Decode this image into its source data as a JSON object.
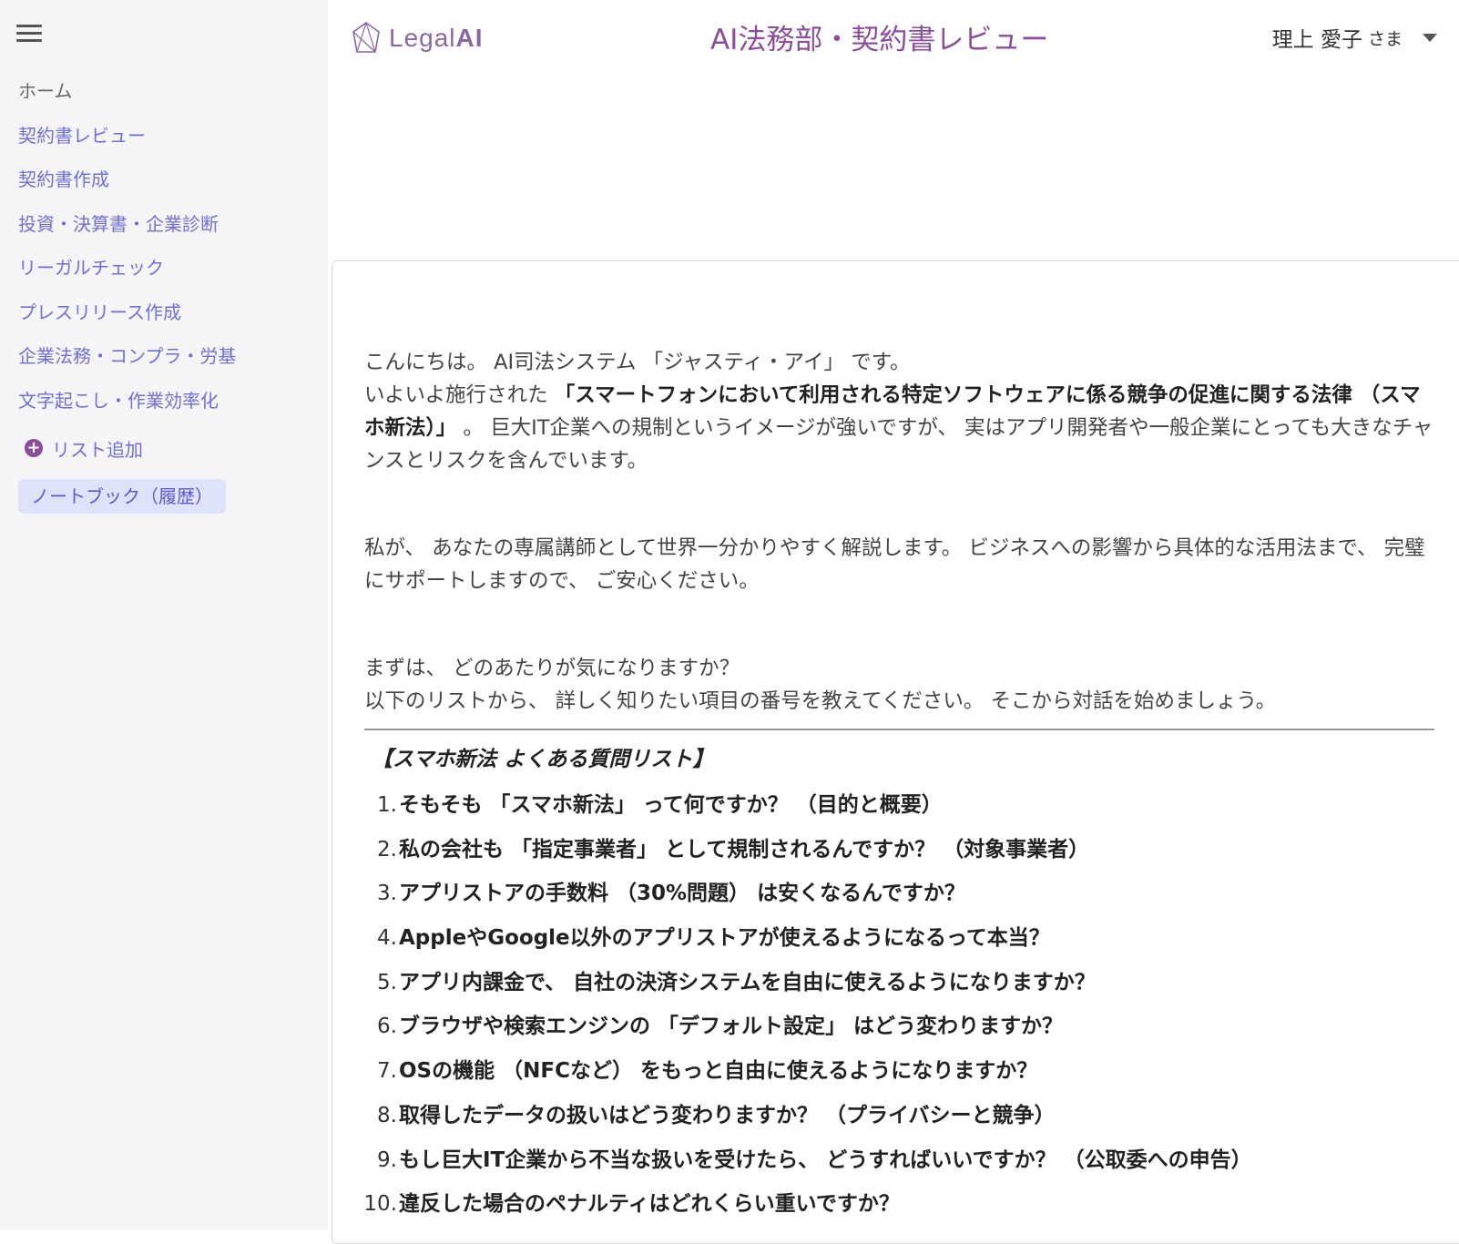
{
  "sidebar": {
    "items": [
      {
        "label": "ホーム"
      },
      {
        "label": "契約書レビュー"
      },
      {
        "label": "契約書作成"
      },
      {
        "label": "投資・決算書・企業診断"
      },
      {
        "label": "リーガルチェック"
      },
      {
        "label": "プレスリリース作成"
      },
      {
        "label": "企業法務・コンプラ・労基"
      },
      {
        "label": "文字起こし・作業効率化"
      }
    ],
    "add_list_label": "リスト追加",
    "notebook_label": "ノートブック（履歴）"
  },
  "header": {
    "logo_word1": "Legal",
    "logo_word2": "AI",
    "title": "AI法務部・契約書レビュー",
    "user_name": "理上 愛子",
    "user_suffix": "さま"
  },
  "message": {
    "line1": "こんにちは。 AI司法システム 「ジャスティ・アイ」 です。",
    "p1_prefix": "いよいよ施行された ",
    "p1_bold": "「スマートフォンにおいて利用される特定ソフトウェアに係る競争の促進に関する法律 （スマホ新法）」",
    "p1_suffix": " 。 巨大IT企業への規制というイメージが強いですが、 実はアプリ開発者や一般企業にとっても大きなチャンスとリスクを含んでいます。",
    "p2": "私が、 あなたの専属講師として世界一分かりやすく解説します。 ビジネスへの影響から具体的な活用法まで、 完璧にサポートしますので、 ご安心ください。",
    "p3_line1": "まずは、 どのあたりが気になりますか？",
    "p3_line2": "以下のリストから、 詳しく知りたい項目の番号を教えてください。 そこから対話を始めましょう。",
    "faq_title": "【スマホ新法 よくある質問リスト】",
    "faq": [
      {
        "num": "1.",
        "text": "そもそも 「スマホ新法」 って何ですか？ （目的と概要）"
      },
      {
        "num": "2.",
        "text": "私の会社も 「指定事業者」 として規制されるんですか？ （対象事業者）"
      },
      {
        "num": "3.",
        "text": "アプリストアの手数料 （30%問題） は安くなるんですか？"
      },
      {
        "num": "4.",
        "text": "AppleやGoogle以外のアプリストアが使えるようになるって本当？"
      },
      {
        "num": "5.",
        "text": "アプリ内課金で、 自社の決済システムを自由に使えるようになりますか？"
      },
      {
        "num": "6.",
        "text": "ブラウザや検索エンジンの 「デフォルト設定」 はどう変わりますか？"
      },
      {
        "num": "7.",
        "text": "OSの機能 （NFCなど） をもっと自由に使えるようになりますか？"
      },
      {
        "num": "8.",
        "text": "取得したデータの扱いはどう変わりますか？ （プライバシーと競争）"
      },
      {
        "num": "9.",
        "text": "もし巨大IT企業から不当な扱いを受けたら、 どうすればいいですか？ （公取委への申告）"
      },
      {
        "num": "10.",
        "text": "違反した場合のペナルティはどれくらい重いですか？"
      }
    ]
  },
  "colors": {
    "accent": "#8a4c9c",
    "nav_link": "#6f6fd8",
    "sidebar_bg": "#f5f5f7",
    "chip_bg": "#dfe3fa"
  },
  "icons": [
    "hamburger-icon",
    "logo-icon",
    "plus-circle-icon",
    "caret-down-icon"
  ]
}
